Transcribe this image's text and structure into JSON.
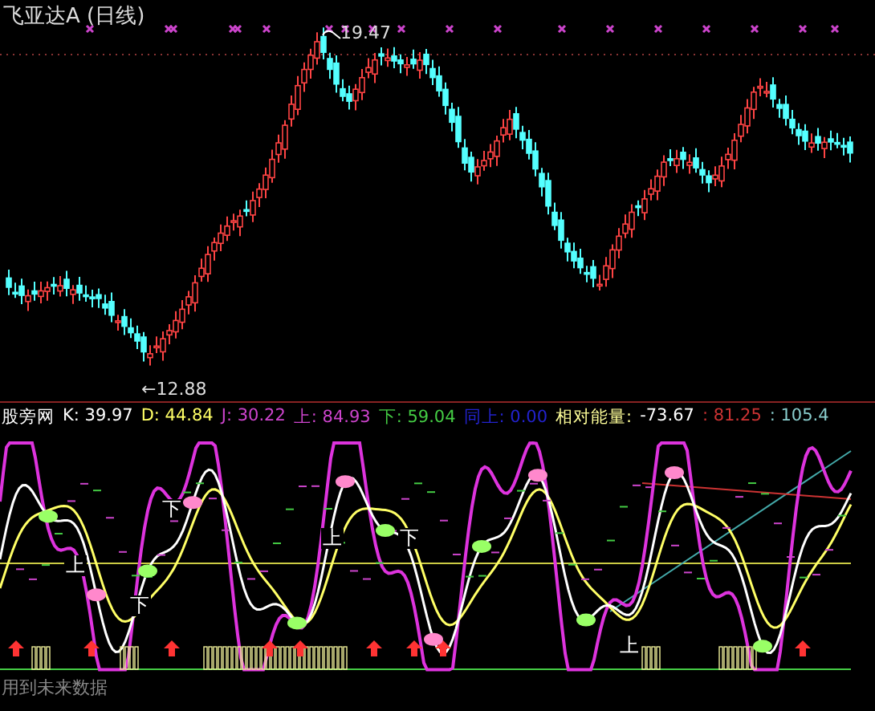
{
  "title": "飞亚达A (日线)",
  "price_labels": [
    {
      "text": "19.47",
      "kind": "high"
    },
    {
      "text": "←12.88",
      "kind": "low"
    }
  ],
  "legend": [
    {
      "text": "股旁网",
      "color": "#ffffff"
    },
    {
      "text": "K: 39.97",
      "color": "#ffffff"
    },
    {
      "text": "D: 44.84",
      "color": "#ffff66"
    },
    {
      "text": "J: 30.22",
      "color": "#cc44cc"
    },
    {
      "text": "上: 84.93",
      "color": "#cc44cc"
    },
    {
      "text": "下: 59.04",
      "color": "#44cc44"
    },
    {
      "text": "同上: 0.00",
      "color": "#2222cc"
    },
    {
      "text": "相对能量:",
      "color": "#ffff99"
    },
    {
      "text": "-73.67",
      "color": "#ffffff"
    },
    {
      "text": ": 81.25",
      "color": "#cc3333"
    },
    {
      "text": ": 105.4",
      "color": "#88cccc"
    }
  ],
  "markers": [
    {
      "text": "下"
    },
    {
      "text": "上"
    },
    {
      "text": "下"
    },
    {
      "text": "上"
    },
    {
      "text": "下"
    },
    {
      "text": "上"
    }
  ],
  "footer": "用到未来数据"
}
